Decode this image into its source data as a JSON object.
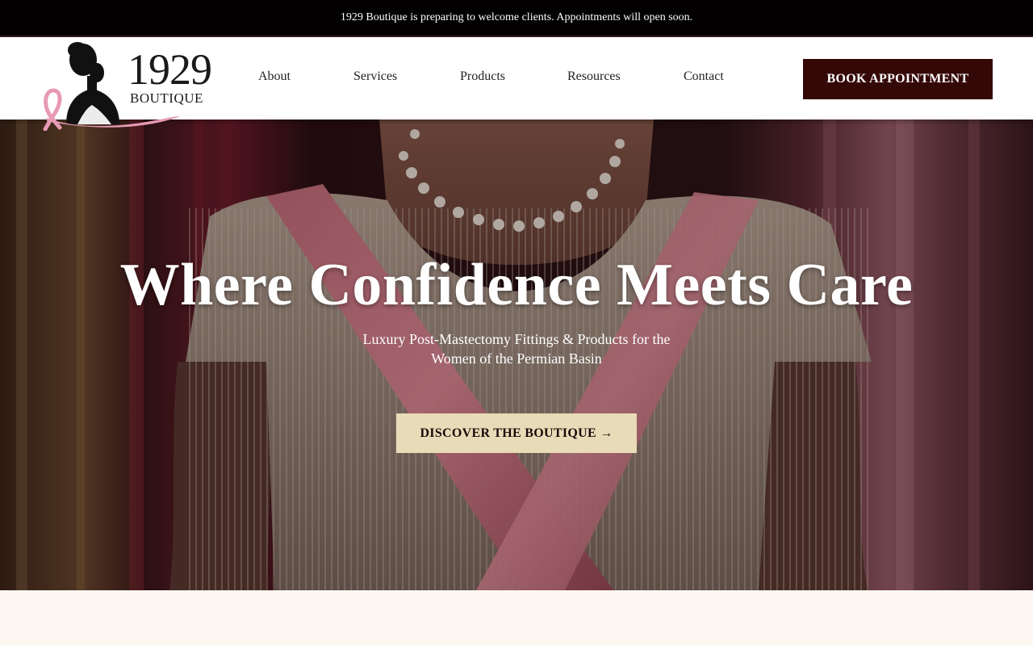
{
  "announcement": {
    "text": "1929 Boutique is preparing to welcome clients. Appointments will open soon."
  },
  "header": {
    "logo": {
      "number": "1929",
      "word": "BOUTIQUE",
      "icon": "silhouette-ribbon-logo"
    },
    "nav": [
      {
        "label": "About"
      },
      {
        "label": "Services"
      },
      {
        "label": "Products"
      },
      {
        "label": "Resources"
      },
      {
        "label": "Contact"
      }
    ],
    "cta_label": "BOOK APPOINTMENT"
  },
  "hero": {
    "title": "Where Confidence Meets Care",
    "subtitle": "Luxury Post-Mastectomy Fittings & Products for the Women of the Permian Basin",
    "cta_label": "DISCOVER THE BOUTIQUE →"
  },
  "colors": {
    "announcement_bg": "#020001",
    "book_button": "#350808",
    "discover_button": "#e8dbb8",
    "ribbon_pink": "#e79ab4",
    "page_bg": "#fdf8f2"
  }
}
